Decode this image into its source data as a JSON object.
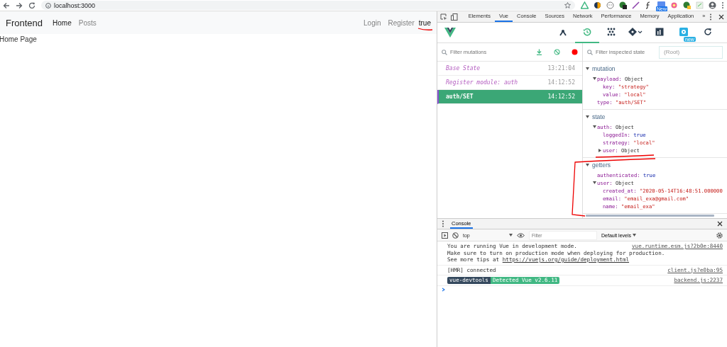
{
  "browser": {
    "url": "localhost:3000",
    "extension_badge": "New"
  },
  "page": {
    "navbar": {
      "brand": "Frontend",
      "links": [
        {
          "label": "Home",
          "selected": true
        },
        {
          "label": "Posts",
          "selected": false
        }
      ],
      "right_links": [
        "Login",
        "Register"
      ],
      "status": "true"
    },
    "content": "Home Page"
  },
  "devtools": {
    "tabs": [
      {
        "label": "Elements",
        "selected": false
      },
      {
        "label": "Vue",
        "selected": true
      },
      {
        "label": "Console",
        "selected": false
      },
      {
        "label": "Sources",
        "selected": false
      },
      {
        "label": "Network",
        "selected": false
      },
      {
        "label": "Performance",
        "selected": false
      },
      {
        "label": "Memory",
        "selected": false
      },
      {
        "label": "Application",
        "selected": false
      }
    ],
    "overflow": "»",
    "vue_toolbar": {
      "tools": [
        {
          "kind": "components",
          "selected": false
        },
        {
          "kind": "vuex",
          "selected": true
        },
        {
          "kind": "events",
          "selected": false
        },
        {
          "kind": "routing",
          "selected": false
        },
        {
          "kind": "performance",
          "selected": false
        },
        {
          "kind": "settings",
          "selected": false,
          "badge": "new"
        },
        {
          "kind": "refresh",
          "selected": false
        }
      ]
    },
    "mutations": {
      "placeholder": "Filter mutations",
      "items": [
        {
          "name": "Base State",
          "time": "13:21:04",
          "kind": "special",
          "selected": false
        },
        {
          "name": "Register module: auth",
          "time": "14:12:52",
          "kind": "special",
          "selected": false
        },
        {
          "name": "auth/SET",
          "time": "14:12:52",
          "kind": "mutation",
          "selected": true
        }
      ]
    },
    "inspector": {
      "placeholder": "Filter inspected state",
      "root_select": "(Root)",
      "sections": [
        {
          "title": "mutation",
          "expanded": true,
          "children": [
            {
              "key": "payload:",
              "value": "Object",
              "kind": "object",
              "expanded": true,
              "children": [
                {
                  "key": "key:",
                  "value": "\"strategy\"",
                  "kind": "string"
                },
                {
                  "key": "value:",
                  "value": "\"local\"",
                  "kind": "string"
                }
              ]
            },
            {
              "key": "type:",
              "value": "\"auth/SET\"",
              "kind": "string"
            }
          ]
        },
        {
          "title": "state",
          "expanded": true,
          "children": [
            {
              "key": "auth:",
              "value": "Object",
              "kind": "object",
              "expanded": true,
              "children": [
                {
                  "key": "loggedIn:",
                  "value": "true",
                  "kind": "boolean"
                },
                {
                  "key": "strategy:",
                  "value": "\"local\"",
                  "kind": "string"
                },
                {
                  "key": "user:",
                  "value": "Object",
                  "kind": "object",
                  "expanded": false
                }
              ]
            }
          ]
        },
        {
          "title": "getters",
          "expanded": true,
          "children": [
            {
              "key": "authenticated:",
              "value": "true",
              "kind": "boolean"
            },
            {
              "key": "user:",
              "value": "Object",
              "kind": "object",
              "expanded": true,
              "children": [
                {
                  "key": "created_at:",
                  "value": "\"2020-05-14T16:48:51.000000",
                  "kind": "string"
                },
                {
                  "key": "email:",
                  "value": "\"email_exa@gmail.com\"",
                  "kind": "string"
                },
                {
                  "key": "name:",
                  "value": "\"email_exa\"",
                  "kind": "string"
                }
              ]
            }
          ]
        }
      ]
    },
    "console": {
      "tab": "Console",
      "context": "top",
      "filter_placeholder": "Filter",
      "levels": "Default levels",
      "messages": [
        {
          "kind": "text",
          "lines": [
            "You are running Vue in development mode.",
            "Make sure to turn on production mode when deploying for production."
          ],
          "link_prefix": "See more tips at ",
          "link": "https://vuejs.org/guide/deployment.html",
          "source": "vue.runtime.esm.js?2b0e:8440"
        },
        {
          "kind": "text",
          "lines": [
            "[HMR] connected"
          ],
          "source": "client.js?e0ba:95"
        },
        {
          "kind": "badges",
          "badges": [
            "vue-devtools",
            "Detected Vue v2.6.11"
          ],
          "source": "backend.js:2237"
        }
      ]
    }
  }
}
